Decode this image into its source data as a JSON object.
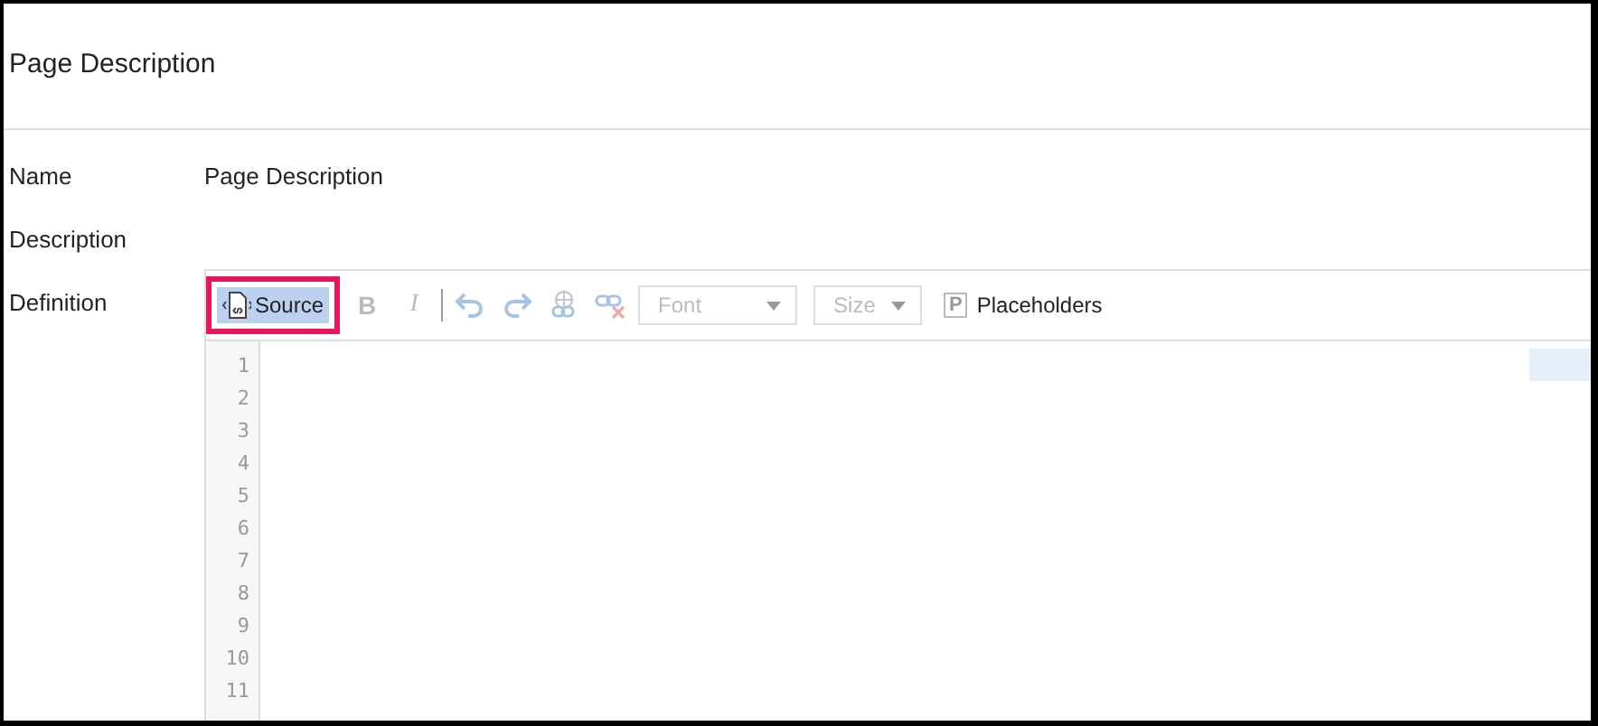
{
  "header": {
    "title": "Page Description"
  },
  "fields": [
    {
      "label": "Name",
      "value": "Page Description"
    },
    {
      "label": "Description"
    },
    {
      "label": "Definition"
    }
  ],
  "toolbar": [
    {
      "kind": "source",
      "label": "Source",
      "selected": true,
      "highlighted": true,
      "disabled": false
    },
    {
      "kind": "bold",
      "label": "B",
      "disabled": true
    },
    {
      "kind": "italic",
      "label": "I",
      "disabled": true
    },
    {
      "kind": "separator"
    },
    {
      "kind": "undo",
      "disabled": true
    },
    {
      "kind": "redo",
      "disabled": true
    },
    {
      "kind": "link",
      "disabled": true
    },
    {
      "kind": "unlink",
      "disabled": true
    },
    {
      "kind": "dropdown",
      "placeholder": "Font",
      "disabled": true
    },
    {
      "kind": "dropdown",
      "placeholder": "Size",
      "disabled": true
    },
    {
      "kind": "placeholders",
      "mark": "P",
      "label": "Placeholders",
      "disabled": false
    }
  ],
  "editor": {
    "line_numbers": [
      "1",
      "2",
      "3",
      "4",
      "5",
      "6",
      "7",
      "8",
      "9",
      "10",
      "11"
    ]
  }
}
